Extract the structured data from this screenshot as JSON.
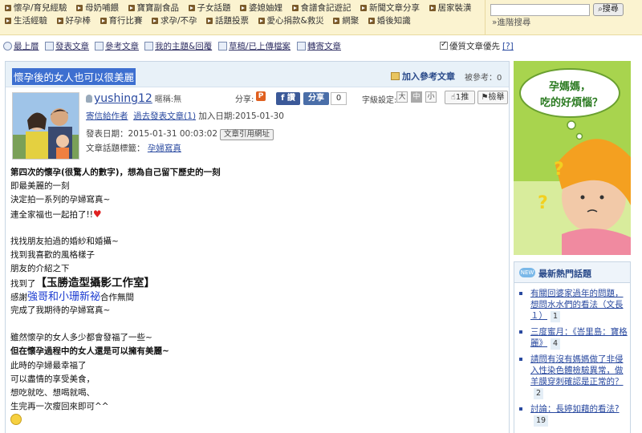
{
  "categories": {
    "row1": [
      "懷孕/育兒經驗",
      "母奶哺餵",
      "寶寶副食品",
      "子女話題",
      "婆媳妯娌",
      "食譜食記遊記",
      "新聞文章分享",
      "居家裝潢"
    ],
    "row2": [
      "生活經驗",
      "好孕棒",
      "育行比賽",
      "求孕/不孕",
      "話題投票",
      "愛心捐款&救災",
      "網聚",
      "婚後知識"
    ]
  },
  "search": {
    "button": "搜尋",
    "advanced": "»進階搜尋"
  },
  "toolbar": {
    "home": "最上層",
    "post": "發表文章",
    "ref": "參考文章",
    "mytopics": "我的主題&回覆",
    "drafts": "草稿/已上傳檔案",
    "forward": "轉寄文章",
    "prefer": "優質文章優先",
    "help": "[?]"
  },
  "article": {
    "title": "懷孕後的女人也可以很美麗",
    "add_ref": "加入參考文章",
    "ref_label": "被參考：0",
    "author": "yushing12",
    "nickname": "暱稱:無",
    "share_label": "分享:",
    "share_p": "P",
    "fb": "f 讚",
    "share_btn": "分享",
    "share_count": "0",
    "font_label": "字級設定:",
    "font_big": "大",
    "font_mid": "中",
    "font_small": "小",
    "push": "1推",
    "report": "檢舉",
    "send_author": "寄信給作者",
    "past_posts": "過去發表文章(1)",
    "join_date": "加入日期:2015-01-30",
    "post_date": "發表日期：2015-01-31 00:03:02",
    "cite": "文章引用網址",
    "tag_label": "文章話題標籤：",
    "tag": "孕婦寫真"
  },
  "body": {
    "l1": "第四次的懷孕(很驚人的數字)，想為自己留下歷史的一刻",
    "l2": "即最美麗的一刻",
    "l3": "決定拍一系列的孕婦寫真~",
    "l4": "連全家福也一起拍了!!",
    "l5": "找找朋友拍過的婚紗和婚攝~",
    "l6": "找到我喜歡的風格樣子",
    "l7": "朋友的介紹之下",
    "l8a": "找到了",
    "l8b": "【玉勝造型攝影工作室】",
    "l9a": "感謝",
    "l9b": "強哥和小珊新祕",
    "l9c": "合作無間",
    "l10": "完成了我期待的孕婦寫真~",
    "l11": "雖然懷孕的女人多少都會發福了一些~",
    "l12": "但在懷孕過程中的女人還是可以擁有美麗~",
    "l13": "此時的孕婦最幸福了",
    "l14": "可以盡情的享受美食，",
    "l15": "想吃就吃、想喝就喝、",
    "l16": "生完再一次瘦回來即可^^"
  },
  "banner": {
    "line1": "孕媽媽，",
    "line2": "吃的好煩惱？"
  },
  "hot": {
    "title": "最新熱門話題",
    "items": [
      {
        "text": "有關回婆家過年的問題，想問水水們的看法（文長１）",
        "count": "1"
      },
      {
        "text": "三度蜜月：《峇里島：寶格麗》",
        "count": "4"
      },
      {
        "text": "請問有沒有媽媽做了非侵入性染色體檢驗異常，做羊膜穿刺確認是正常的？",
        "count": "2"
      },
      {
        "text": "討論：長婷如藉的看法?",
        "count": "19"
      }
    ]
  },
  "colors": {
    "band": "#fbf3d0",
    "title_highlight": "#3d6fd0",
    "link": "#2a4aa0",
    "banner": "#a8d44e"
  }
}
